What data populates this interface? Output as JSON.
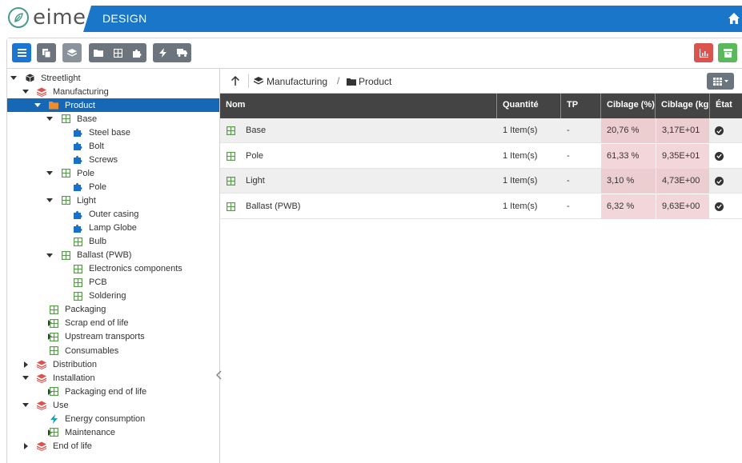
{
  "header": {
    "logo_text": "eime",
    "module_title": "DESIGN"
  },
  "tree": {
    "root": "Streetlight",
    "items": [
      {
        "label": "Manufacturing"
      },
      {
        "label": "Product"
      },
      {
        "label": "Base"
      },
      {
        "label": "Steel base"
      },
      {
        "label": "Bolt"
      },
      {
        "label": "Screws"
      },
      {
        "label": "Pole"
      },
      {
        "label": "Pole"
      },
      {
        "label": "Light"
      },
      {
        "label": "Outer casing"
      },
      {
        "label": "Lamp Globe"
      },
      {
        "label": "Bulb"
      },
      {
        "label": "Ballast (PWB)"
      },
      {
        "label": "Electronics components"
      },
      {
        "label": "PCB"
      },
      {
        "label": "Soldering"
      },
      {
        "label": "Packaging"
      },
      {
        "label": "Scrap end of life"
      },
      {
        "label": "Upstream transports"
      },
      {
        "label": "Consumables"
      },
      {
        "label": "Distribution"
      },
      {
        "label": "Installation"
      },
      {
        "label": "Packaging end of life"
      },
      {
        "label": "Use"
      },
      {
        "label": "Energy consumption"
      },
      {
        "label": "Maintenance"
      },
      {
        "label": "End of life"
      }
    ]
  },
  "breadcrumb": {
    "items": [
      "Manufacturing",
      "Product"
    ],
    "separator": "/"
  },
  "table": {
    "columns": [
      "Nom",
      "Quantité",
      "TP",
      "Ciblage (%)",
      "Ciblage (kg",
      "État"
    ],
    "rows": [
      {
        "nom": "Base",
        "quantite": "1 Item(s)",
        "tp": "-",
        "ciblage_pct": "20,76 %",
        "ciblage_kg": "3,17E+01"
      },
      {
        "nom": "Pole",
        "quantite": "1 Item(s)",
        "tp": "-",
        "ciblage_pct": "61,33 %",
        "ciblage_kg": "9,35E+01"
      },
      {
        "nom": "Light",
        "quantite": "1 Item(s)",
        "tp": "-",
        "ciblage_pct": "3,10 %",
        "ciblage_kg": "4,73E+00"
      },
      {
        "nom": "Ballast (PWB)",
        "quantite": "1 Item(s)",
        "tp": "-",
        "ciblage_pct": "6,32 %",
        "ciblage_kg": "9,63E+00"
      }
    ]
  },
  "colors": {
    "brand_blue": "#1976c9",
    "selected": "#1668b4",
    "stage_red": "#d9534f",
    "component_green": "#5a9e4b",
    "part_blue": "#1a6fc9",
    "energy_teal": "#17a2b8"
  }
}
